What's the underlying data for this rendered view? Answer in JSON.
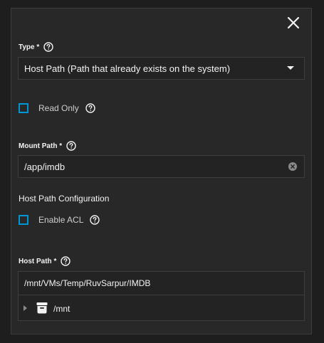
{
  "dialog": {
    "close_icon": "close-icon"
  },
  "type_field": {
    "label": "Type *",
    "help_icon": "help-circle-icon",
    "selected_value": "Host Path (Path that already exists on the system)",
    "dropdown_icon": "chevron-down-icon"
  },
  "read_only": {
    "label": "Read Only",
    "checked": false,
    "help_icon": "help-circle-icon"
  },
  "mount_path": {
    "label": "Mount Path *",
    "help_icon": "help-circle-icon",
    "value": "/app/imdb",
    "clear_icon": "clear-circle-icon"
  },
  "host_path_config": {
    "title": "Host Path Configuration",
    "enable_acl": {
      "label": "Enable ACL",
      "checked": false,
      "help_icon": "help-circle-icon"
    }
  },
  "host_path": {
    "label": "Host Path *",
    "help_icon": "help-circle-icon",
    "value": "/mnt/VMs/Temp/RuvSarpur/IMDB",
    "tree": [
      {
        "label": "/mnt",
        "icon": "dataset-icon",
        "expanded": false
      }
    ]
  },
  "colors": {
    "accent": "#0095d5",
    "panel_bg": "#282828",
    "page_bg": "#1e1e1e",
    "border": "#3d3d3d"
  }
}
